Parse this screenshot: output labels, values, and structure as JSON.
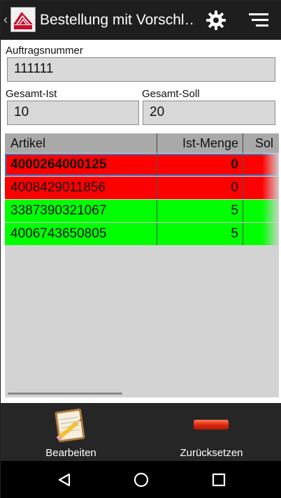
{
  "app_bar": {
    "back_glyph": "‹",
    "title": "Bestellung mit Vorschl…",
    "logo_icon": "costs-logo-icon",
    "settings_icon": "gear-icon",
    "menu_icon": "sort-menu-icon"
  },
  "form": {
    "order_label": "Auftragsnummer",
    "order_value": "111111",
    "total_actual_label": "Gesamt-Ist",
    "total_actual_value": "10",
    "total_target_label": "Gesamt-Soll",
    "total_target_value": "20"
  },
  "table": {
    "columns": [
      "Artikel",
      "Ist-Menge",
      "Sol"
    ],
    "rows": [
      {
        "artikel": "4000264000125",
        "ist": "0",
        "status": "red",
        "selected": true
      },
      {
        "artikel": "4008429011856",
        "ist": "0",
        "status": "red",
        "selected": false
      },
      {
        "artikel": "3387390321067",
        "ist": "5",
        "status": "green",
        "selected": false
      },
      {
        "artikel": "4006743650805",
        "ist": "5",
        "status": "green",
        "selected": false
      }
    ]
  },
  "buttons": {
    "edit_label": "Bearbeiten",
    "reset_label": "Zurücksetzen"
  },
  "colors": {
    "row_red": "#ff0000",
    "row_green": "#00ff00",
    "selection_border": "#3a78c8",
    "grid_bg": "#d3d3d3",
    "header_bg": "#a9a9a9"
  }
}
